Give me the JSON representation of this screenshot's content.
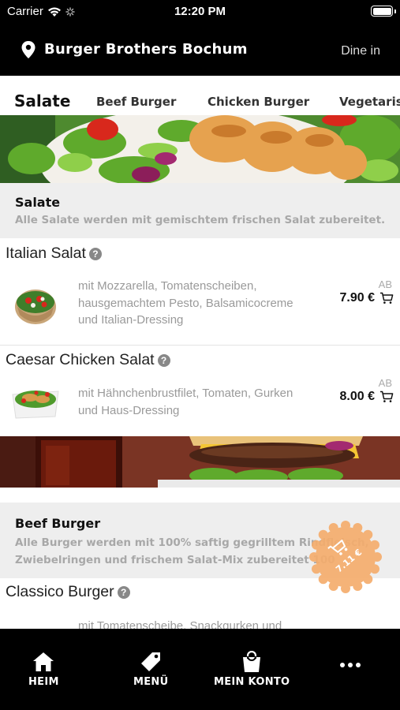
{
  "status_bar": {
    "carrier": "Carrier",
    "time": "12:20 PM"
  },
  "header": {
    "store_name": "Burger Brothers Bochum",
    "mode": "Dine in"
  },
  "tabs": [
    {
      "label": "Salate",
      "active": true
    },
    {
      "label": "Beef Burger",
      "active": false
    },
    {
      "label": "Chicken Burger",
      "active": false
    },
    {
      "label": "Vegetarisch",
      "active": false
    }
  ],
  "sections": {
    "salate": {
      "title": "Salate",
      "description": "Alle Salate werden mit gemischtem frischen Salat zubereitet."
    },
    "beef": {
      "title": "Beef Burger",
      "description_line1": "Alle Burger werden mit 100% saftig gegrilltem Rindfleisch,",
      "description_line2": "Zwiebelringen und frischem Salat-Mix zubereitet 100"
    }
  },
  "products": [
    {
      "name": "Italian Salat",
      "desc_line1": "mit Mozzarella, Tomatenscheiben,",
      "desc_line2": "hausgemachtem Pesto, Balsamicocreme",
      "desc_line3": "und Italian-Dressing",
      "ab": "AB",
      "price": "7.90 €"
    },
    {
      "name": "Caesar Chicken Salat",
      "desc_line1": "mit Hähnchenbrustfilet, Tomaten, Gurken",
      "desc_line2": "und Haus-Dressing",
      "ab": "AB",
      "price": "8.00 €"
    },
    {
      "name": "Classico Burger",
      "desc_line1": "mit Tomatenscheibe, Snackgurken und"
    }
  ],
  "cart_fab": {
    "amount": "7.11 €",
    "color": "#f5ad6d"
  },
  "bottom_nav": {
    "home": "HEIM",
    "menu": "MENÜ",
    "account": "MEIN KONTO"
  },
  "colors": {
    "bar": "#000000",
    "section_bg": "#eeeeee",
    "accent": "#f5ad6d"
  }
}
